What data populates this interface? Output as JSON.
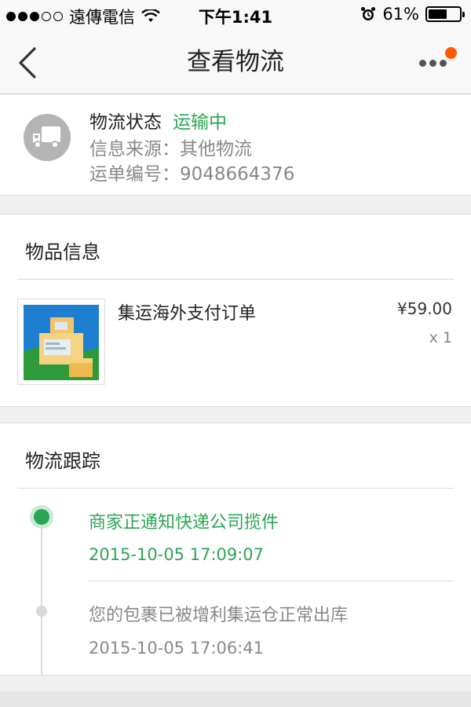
{
  "status_bar": {
    "carrier": "遠傳電信",
    "time": "下午1:41",
    "battery": "61%",
    "battery_level": 0.61
  },
  "nav": {
    "title": "查看物流"
  },
  "shipment": {
    "status_label": "物流状态",
    "status_value": "运输中",
    "source": "信息来源：其他物流",
    "tracking": "运单编号：9048664376"
  },
  "goods": {
    "title": "物品信息",
    "item": {
      "name": "集运海外支付订单",
      "price": "¥59.00",
      "qty": "x 1"
    }
  },
  "tracking": {
    "title": "物流跟踪",
    "events": [
      {
        "text": "商家正通知快递公司揽件",
        "time": "2015-10-05 17:09:07"
      },
      {
        "text": "您的包裹已被增利集运仓正常出库",
        "time": "2015-10-05 17:06:41"
      }
    ]
  },
  "colors": {
    "accent_green": "#2aa655",
    "badge_orange": "#ff5a00"
  }
}
